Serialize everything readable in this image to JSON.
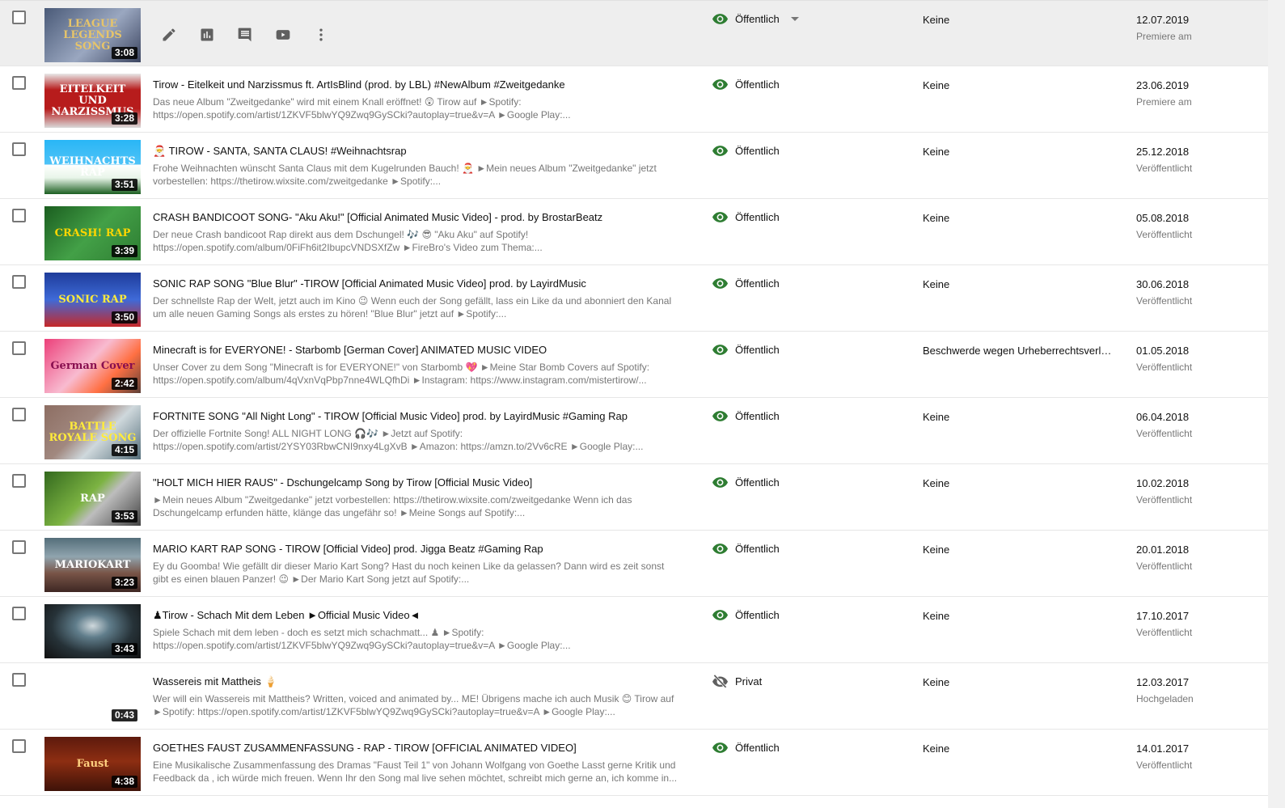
{
  "colors": {
    "public": "#2e7d32",
    "private": "#606060"
  },
  "rows": [
    {
      "duration": "3:08",
      "thumb_text": "LEAGUE LEGENDS SONG",
      "thumb_bg": "linear-gradient(135deg,#4a5a78,#9aa7c0 55%,#3c4560)",
      "thumb_fg": "#e6c46a",
      "title": "",
      "description": "",
      "visibility": "Öffentlich",
      "vis_type": "public",
      "restrictions": "Keine",
      "date": "12.07.2019",
      "date_status": "Premiere am",
      "hovered": true
    },
    {
      "duration": "3:28",
      "thumb_text": "EITELKEIT UND NARZISSMUS",
      "thumb_bg": "linear-gradient(180deg,#e8e8e8 0%,#b71c1c 30%,#b71c1c 65%,#d9d9d9 100%)",
      "thumb_fg": "#ffffff",
      "title": "Tirow - Eitelkeit und Narzissmus ft. ArtIsBlind (prod. by LBL) #NewAlbum #Zweitgedanke",
      "description": "Das neue Album \"Zweitgedanke\" wird mit einem Knall eröffnet! 😲 Tirow auf ►Spotify: https://open.spotify.com/artist/1ZKVF5blwYQ9Zwq9GySCki?autoplay=true&v=A ►Google Play:...",
      "visibility": "Öffentlich",
      "vis_type": "public",
      "restrictions": "Keine",
      "date": "23.06.2019",
      "date_status": "Premiere am"
    },
    {
      "duration": "3:51",
      "thumb_text": "WEIHNACHTS RAP",
      "thumb_bg": "linear-gradient(180deg,#29b6f6 0%,#4fc3f7 45%,#ffffff 46%,#e8f5e9 70%,#1b5e20 100%)",
      "thumb_fg": "#ffffff",
      "title": "🎅 TIROW - SANTA, SANTA CLAUS! #Weihnachtsrap",
      "description": "Frohe Weihnachten wünscht Santa Claus mit dem Kugelrunden Bauch! 🎅 ►Mein neues Album \"Zweitgedanke\" jetzt vorbestellen: https://thetirow.wixsite.com/zweitgedanke ►Spotify:...",
      "visibility": "Öffentlich",
      "vis_type": "public",
      "restrictions": "Keine",
      "date": "25.12.2018",
      "date_status": "Veröffentlicht"
    },
    {
      "duration": "3:39",
      "thumb_text": "CRASH! RAP",
      "thumb_bg": "linear-gradient(135deg,#1b5e20,#43a047 50%,#2e7d32)",
      "thumb_fg": "#ffd600",
      "title": "CRASH BANDICOOT SONG- \"Aku Aku!\" [Official Animated Music Video] - prod. by BrostarBeatz",
      "description": "Der neue Crash bandicoot Rap direkt aus dem Dschungel! 🎶 😎 \"Aku Aku\" auf Spotify! https://open.spotify.com/album/0FiFh6it2IbupcVNDSXfZw ►FireBro's Video zum Thema:...",
      "visibility": "Öffentlich",
      "vis_type": "public",
      "restrictions": "Keine",
      "date": "05.08.2018",
      "date_status": "Veröffentlicht"
    },
    {
      "duration": "3:50",
      "thumb_text": "SONIC RAP",
      "thumb_bg": "linear-gradient(180deg,#1e3c9a,#3f6ad8 50%,#c62828 100%)",
      "thumb_fg": "#ffeb3b",
      "title": "SONIC RAP SONG \"Blue Blur\" -TIROW [Official Animated Music Video] prod. by LayirdMusic",
      "description": "Der schnellste Rap der Welt, jetzt auch im Kino 😉 Wenn euch der Song gefällt, lass ein Like da und abonniert den Kanal um alle neuen Gaming Songs als erstes zu hören! \"Blue Blur\" jetzt auf ►Spotify:...",
      "visibility": "Öffentlich",
      "vis_type": "public",
      "restrictions": "Keine",
      "date": "30.06.2018",
      "date_status": "Veröffentlicht"
    },
    {
      "duration": "2:42",
      "thumb_text": "German Cover",
      "thumb_bg": "linear-gradient(135deg,#ec407a,#f8bbd0 45%,#ff7043 70%,#5d4037)",
      "thumb_fg": "#880e4f",
      "title": "Minecraft is for EVERYONE! - Starbomb [German Cover] ANIMATED MUSIC VIDEO",
      "description": "Unser Cover zu dem Song \"Minecraft is for EVERYONE!\" von Starbomb 💖 ►Meine Star Bomb Covers auf Spotify: https://open.spotify.com/album/4qVxnVqPbp7nne4WLQfhDi ►Instagram: https://www.instagram.com/mistertirow/...",
      "visibility": "Öffentlich",
      "vis_type": "public",
      "restrictions": "Beschwerde wegen Urheberrechtsverletzung",
      "date": "01.05.2018",
      "date_status": "Veröffentlicht"
    },
    {
      "duration": "4:15",
      "thumb_text": "BATTLE ROYALE SONG",
      "thumb_bg": "linear-gradient(135deg,#8d6e63,#a1887f 40%,#cfd8dc 60%,#546e7a)",
      "thumb_fg": "#ffeb3b",
      "title": "FORTNITE SONG \"All Night Long\" - TIROW [Official Music Video] prod. by LayirdMusic #Gaming Rap",
      "description": "Der offizielle Fortnite Song! ALL NIGHT LONG 🎧🎶 ►Jetzt auf Spotify: https://open.spotify.com/artist/2YSY03RbwCNI9nxy4LgXvB ►Amazon: https://amzn.to/2Vv6cRE ►Google Play:...",
      "visibility": "Öffentlich",
      "vis_type": "public",
      "restrictions": "Keine",
      "date": "06.04.2018",
      "date_status": "Veröffentlicht"
    },
    {
      "duration": "3:53",
      "thumb_text": "RAP",
      "thumb_bg": "linear-gradient(135deg,#33691e,#7cb342 45%,#bdbdbd 60%,#424242)",
      "thumb_fg": "#ffffff",
      "title": "\"HOLT MICH HIER RAUS\" - Dschungelcamp Song by Tirow [Official Music Video]",
      "description": "►Mein neues Album \"Zweitgedanke\" jetzt vorbestellen: https://thetirow.wixsite.com/zweitgedanke Wenn ich das Dschungelcamp erfunden hätte, klänge das ungefähr so! ►Meine Songs auf Spotify:...",
      "visibility": "Öffentlich",
      "vis_type": "public",
      "restrictions": "Keine",
      "date": "10.02.2018",
      "date_status": "Veröffentlicht"
    },
    {
      "duration": "3:23",
      "thumb_text": "MARIOKART",
      "thumb_bg": "linear-gradient(180deg,#546e7a,#90a4ae 35%,#795548 65%,#3e2723)",
      "thumb_fg": "#ffffff",
      "title": "MARIO KART RAP SONG - TIROW [Official Video] prod. Jigga Beatz #Gaming Rap",
      "description": "Ey du Goomba! Wie gefällt dir dieser Mario Kart Song? Hast du noch keinen Like da gelassen? Dann wird es zeit sonst gibt es einen blauen Panzer! 😉 ►Der Mario Kart Song jetzt auf Spotify:...",
      "visibility": "Öffentlich",
      "vis_type": "public",
      "restrictions": "Keine",
      "date": "20.01.2018",
      "date_status": "Veröffentlicht"
    },
    {
      "duration": "3:43",
      "thumb_text": "",
      "thumb_bg": "radial-gradient(ellipse at 50% 40%,#cfd8dc 0%,#607d8b 25%,#263238 60%,#111 100%)",
      "thumb_fg": "#ffffff",
      "title": "♟Tirow - Schach Mit dem Leben ►Official Music Video◄",
      "description": "Spiele Schach mit dem leben - doch es setzt mich schachmatt... ♟ ►Spotify: https://open.spotify.com/artist/1ZKVF5blwYQ9Zwq9GySCki?autoplay=true&v=A ►Google Play:...",
      "visibility": "Öffentlich",
      "vis_type": "public",
      "restrictions": "Keine",
      "date": "17.10.2017",
      "date_status": "Veröffentlicht"
    },
    {
      "duration": "0:43",
      "thumb_text": "",
      "thumb_bg": "#ffffff",
      "thumb_fg": "#000000",
      "title": "Wassereis mit Mattheis 🍦",
      "description": "Wer will ein Wassereis mit Mattheis? Written, voiced and animated by... ME! Übrigens mache ich auch Musik 😊 Tirow auf ►Spotify: https://open.spotify.com/artist/1ZKVF5blwYQ9Zwq9GySCki?autoplay=true&v=A ►Google Play:...",
      "visibility": "Privat",
      "vis_type": "private",
      "restrictions": "Keine",
      "date": "12.03.2017",
      "date_status": "Hochgeladen"
    },
    {
      "duration": "4:38",
      "thumb_text": "Faust",
      "thumb_bg": "linear-gradient(180deg,#5d1a0d,#8d2e12 45%,#3e1208)",
      "thumb_fg": "#ffd180",
      "title": "GOETHES FAUST ZUSAMMENFASSUNG - RAP - TIROW [OFFICIAL ANIMATED VIDEO]",
      "description": "Eine Musikalische Zusammenfassung des Dramas \"Faust Teil 1\" von Johann Wolfgang von Goethe Lasst gerne Kritik und Feedback da , ich würde mich freuen. Wenn Ihr den Song mal live sehen möchtet, schreibt mich gerne an, ich komme in...",
      "visibility": "Öffentlich",
      "vis_type": "public",
      "restrictions": "Keine",
      "date": "14.01.2017",
      "date_status": "Veröffentlicht"
    }
  ]
}
